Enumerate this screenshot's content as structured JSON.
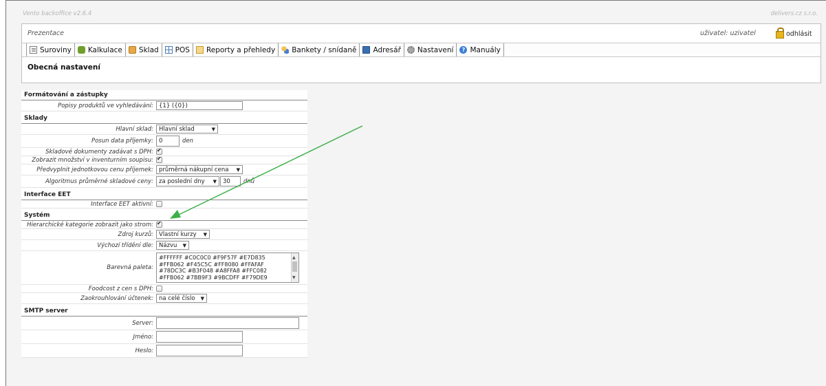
{
  "app": {
    "version": "Vento backoffice v2.6.4",
    "company": "delivers.cz s.r.o."
  },
  "header": {
    "location": "Prezentace",
    "user": "uživatel: uzivatel",
    "logout": "odhlásit"
  },
  "menu": [
    {
      "label": "Suroviny",
      "icon": "document-list-icon"
    },
    {
      "label": "Kalkulace",
      "icon": "puzzle-icon"
    },
    {
      "label": "Sklad",
      "icon": "box-icon"
    },
    {
      "label": "POS",
      "icon": "grid-icon"
    },
    {
      "label": "Reporty a přehledy",
      "icon": "report-icon"
    },
    {
      "label": "Bankety / snídaně",
      "icon": "people-icon"
    },
    {
      "label": "Adresář",
      "icon": "address-book-icon"
    },
    {
      "label": "Nastavení",
      "icon": "gear-icon"
    },
    {
      "label": "Manuály",
      "icon": "help-icon"
    }
  ],
  "page_title": "Obecná nastavení",
  "sections": {
    "formatting": {
      "title": "Formátování a zástupky",
      "product_desc_label": "Popisy produktů ve vyhledávání:",
      "product_desc_value": "{1} ({0})"
    },
    "warehouses": {
      "title": "Sklady",
      "main_label": "Hlavní sklad:",
      "main_value": "Hlavní sklad",
      "shift_label": "Posun data příjemky:",
      "shift_value": "0",
      "shift_unit": "den",
      "vat_docs_label": "Skladové dokumenty zadávat s DPH:",
      "inventory_qty_label": "Zobrazit množství v inventurním soupisu:",
      "prefill_label": "Předvyplnit jednotkovou cenu příjemek:",
      "prefill_value": "průměrná nákupní cena",
      "algo_label": "Algoritmus průměrné skladové ceny:",
      "algo_value": "za poslední dny",
      "algo_days": "30",
      "algo_unit": "dnů"
    },
    "eet": {
      "title": "Interface EET",
      "active_label": "Interface EET aktivní:"
    },
    "system": {
      "title": "Systém",
      "tree_label": "Hierarchické kategorie zobrazit jako strom:",
      "rates_label": "Zdroj kurzů:",
      "rates_value": "Vlastní kurzy",
      "sort_label": "Výchozí třídění dle:",
      "sort_value": "Názvu",
      "palette_label": "Barevná paleta:",
      "palette_lines": [
        "#FFFFFF #C0C0C0 #F9F57F #E7D835",
        "#FFB062 #F45C5C #FF8080 #FFAFAF",
        "#78DC3C #B3F048 #A8FFA8 #FFC082",
        "#FFB062 #7BB9F3 #9BCDFF #F79DE9"
      ],
      "foodcost_label": "Foodcost z cen s DPH:",
      "rounding_label": "Zaokrouhlování účtenek:",
      "rounding_value": "na celé číslo"
    },
    "smtp": {
      "title": "SMTP server",
      "server_label": "Server:",
      "name_label": "Jméno:",
      "password_label": "Heslo:"
    }
  },
  "colors": {
    "annotation_arrow": "#3cb04a"
  }
}
